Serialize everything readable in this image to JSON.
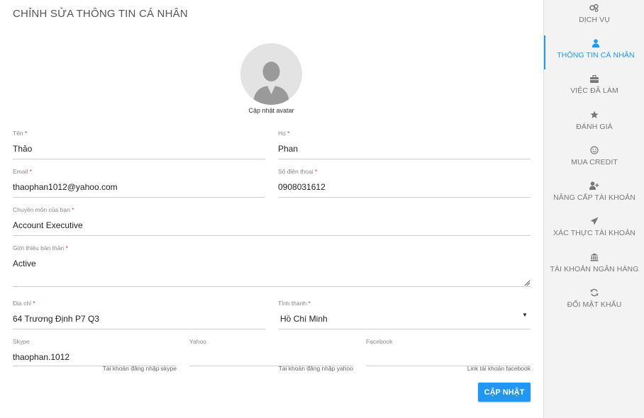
{
  "page": {
    "title": "CHỈNH SỬA THÔNG TIN CÁ NHÂN",
    "avatar_link": "Cập nhật avatar"
  },
  "colors": {
    "accent": "#2196f3",
    "required": "#e53935"
  },
  "form": {
    "first_name": {
      "label": "Tên",
      "value": "Thảo",
      "required": true
    },
    "last_name": {
      "label": "Họ",
      "value": "Phan",
      "required": true
    },
    "email": {
      "label": "Email",
      "value": "thaophan1012@yahoo.com",
      "required": true
    },
    "phone": {
      "label": "Số điện thoại",
      "value": "0908031612",
      "required": true
    },
    "specialty": {
      "label": "Chuyên môn của bạn",
      "value": "Account Executive",
      "required": true
    },
    "intro": {
      "label": "Giới thiệu bản thân",
      "value": "Active",
      "required": true
    },
    "address": {
      "label": "Địa chỉ",
      "value": "64 Trương Định P7 Q3",
      "required": true
    },
    "city": {
      "label": "Tỉnh thành",
      "value": "Hồ Chí Minh",
      "required": true
    },
    "skype": {
      "label": "Skype",
      "value": "thaophan.1012",
      "hint": "Tài khoản đăng nhập skype"
    },
    "yahoo": {
      "label": "Yahoo",
      "value": "",
      "hint": "Tài khoản đăng nhập yahoo"
    },
    "facebook": {
      "label": "Facebook",
      "value": "",
      "hint": "Link tài khoản facebook"
    },
    "submit_label": "CẬP NHẬT"
  },
  "sidebar": {
    "items": [
      {
        "label": "DỊCH VỤ",
        "icon": "services-icon",
        "active": false
      },
      {
        "label": "THÔNG TIN CÁ NHÂN",
        "icon": "user-icon",
        "active": true
      },
      {
        "label": "VIỆC ĐÃ LÀM",
        "icon": "briefcase-icon",
        "active": false
      },
      {
        "label": "ĐÁNH GIÁ",
        "icon": "star-icon",
        "active": false
      },
      {
        "label": "MUA CREDIT",
        "icon": "smile-icon",
        "active": false
      },
      {
        "label": "NÂNG CẤP TÀI KHOẢN",
        "icon": "user-plus-icon",
        "active": false
      },
      {
        "label": "XÁC THỰC TÀI KHOẢN",
        "icon": "paper-plane-icon",
        "active": false
      },
      {
        "label": "TÀI KHOẢN NGÂN HÀNG",
        "icon": "bank-icon",
        "active": false
      },
      {
        "label": "ĐỔI MẬT KHẨU",
        "icon": "refresh-icon",
        "active": false
      }
    ]
  }
}
